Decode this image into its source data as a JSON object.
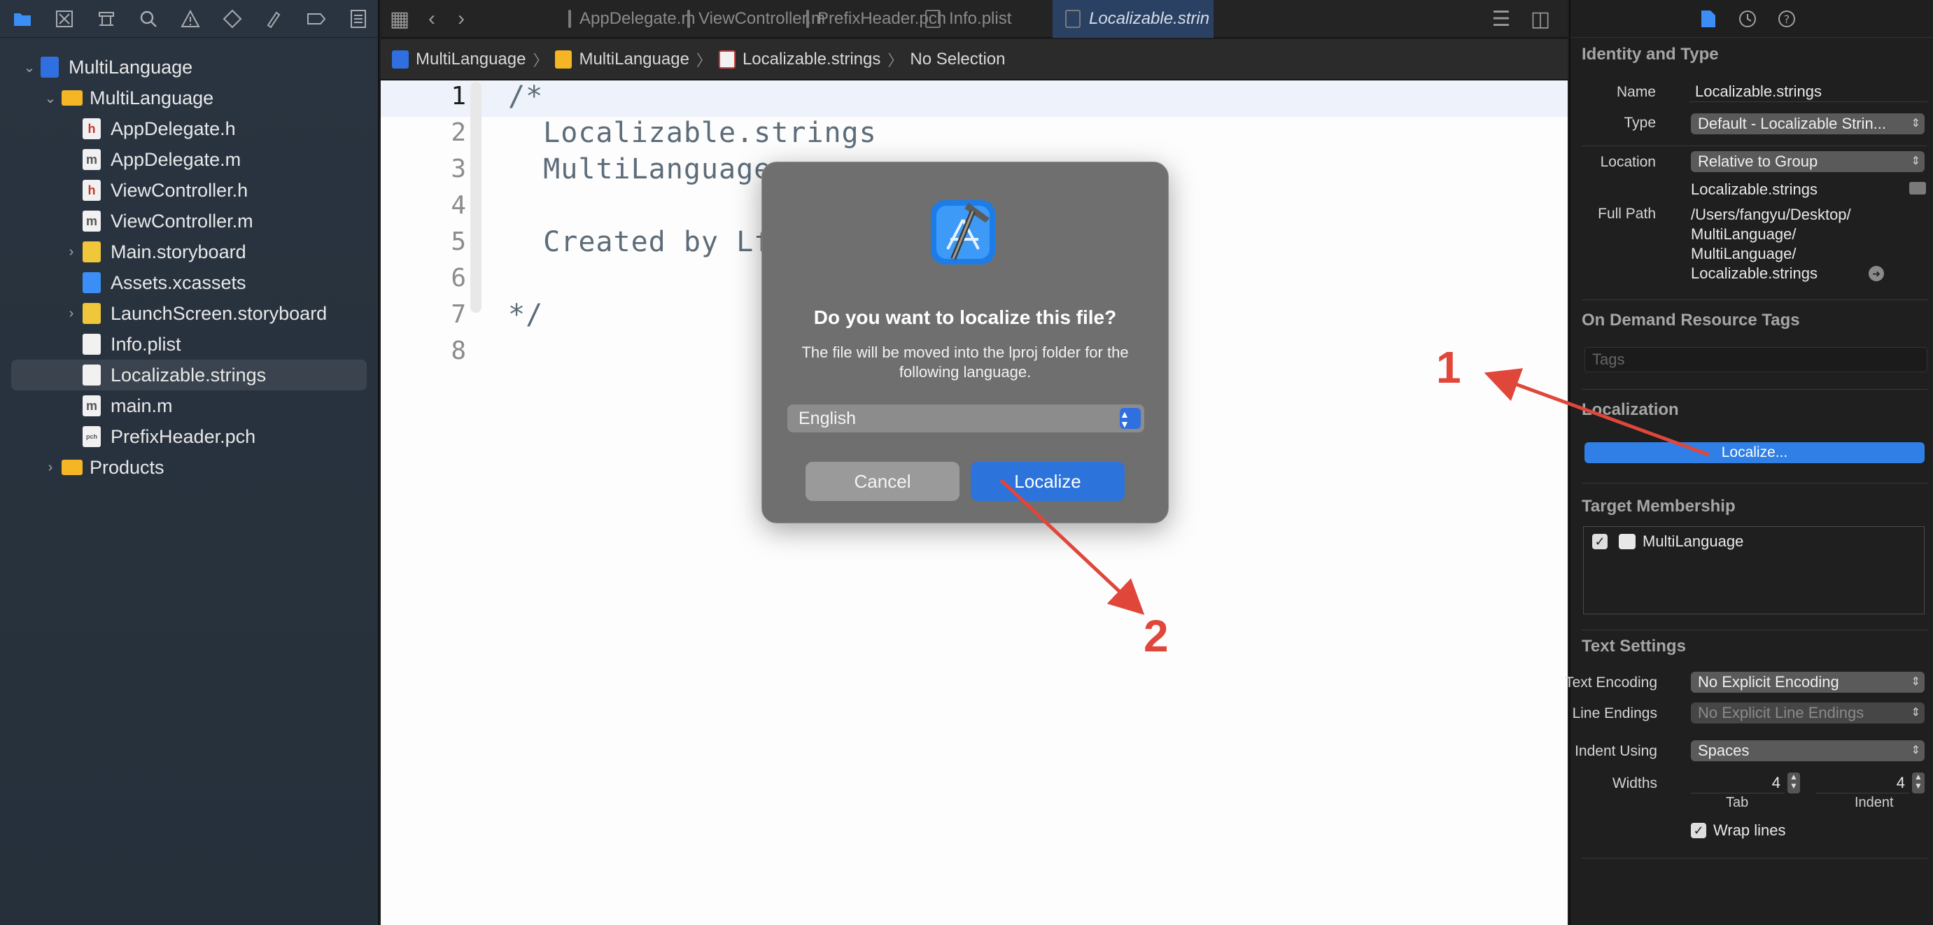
{
  "navigator": {
    "toolbar_icons": [
      "folder-icon",
      "source-control-icon",
      "symbol-icon",
      "find-icon",
      "issue-icon",
      "test-icon",
      "debug-icon",
      "breakpoint-icon",
      "report-icon"
    ],
    "tree": [
      {
        "label": "MultiLanguage",
        "kind": "project",
        "depth": 0,
        "expanded": true
      },
      {
        "label": "MultiLanguage",
        "kind": "folder",
        "depth": 1,
        "expanded": true
      },
      {
        "label": "AppDelegate.h",
        "kind": "h",
        "depth": 2
      },
      {
        "label": "AppDelegate.m",
        "kind": "m",
        "depth": 2
      },
      {
        "label": "ViewController.h",
        "kind": "h",
        "depth": 2
      },
      {
        "label": "ViewController.m",
        "kind": "m",
        "depth": 2
      },
      {
        "label": "Main.storyboard",
        "kind": "storyboard",
        "depth": 2,
        "expanded": false
      },
      {
        "label": "Assets.xcassets",
        "kind": "assets",
        "depth": 2
      },
      {
        "label": "LaunchScreen.storyboard",
        "kind": "storyboard",
        "depth": 2,
        "expanded": false
      },
      {
        "label": "Info.plist",
        "kind": "plist",
        "depth": 2
      },
      {
        "label": "Localizable.strings",
        "kind": "strings",
        "depth": 2,
        "selected": true
      },
      {
        "label": "main.m",
        "kind": "m",
        "depth": 2
      },
      {
        "label": "PrefixHeader.pch",
        "kind": "pch",
        "depth": 2
      },
      {
        "label": "Products",
        "kind": "folder",
        "depth": 1,
        "expanded": false
      }
    ]
  },
  "tabs": [
    {
      "label": "AppDelegate.m",
      "active": false
    },
    {
      "label": "ViewController.m",
      "active": false
    },
    {
      "label": "PrefixHeader.pch",
      "active": false
    },
    {
      "label": "Info.plist",
      "active": false
    },
    {
      "label": "Localizable.strin",
      "active": true
    }
  ],
  "jumpbar": {
    "project": "MultiLanguage",
    "group": "MultiLanguage",
    "file": "Localizable.strings",
    "selection": "No Selection"
  },
  "editor": {
    "current_line": 1,
    "lines": [
      "/*",
      "  Localizable.strings",
      "  MultiLanguage",
      "",
      "  Created by Lf",
      "",
      "*/",
      ""
    ]
  },
  "dialog": {
    "title": "Do you want to localize this file?",
    "message": "The file will be moved into the lproj folder for the following language.",
    "language": "English",
    "cancel": "Cancel",
    "confirm": "Localize"
  },
  "inspector": {
    "identity": {
      "section": "Identity and Type",
      "name_label": "Name",
      "name_value": "Localizable.strings",
      "type_label": "Type",
      "type_value": "Default - Localizable Strin...",
      "location_label": "Location",
      "location_value": "Relative to Group",
      "location_file": "Localizable.strings",
      "fullpath_label": "Full Path",
      "fullpath_lines": [
        "/Users/fangyu/Desktop/",
        "MultiLanguage/",
        "MultiLanguage/",
        "Localizable.strings"
      ]
    },
    "ondemand": {
      "section": "On Demand Resource Tags",
      "placeholder": "Tags"
    },
    "localization": {
      "section": "Localization",
      "button": "Localize..."
    },
    "membership": {
      "section": "Target Membership",
      "target": "MultiLanguage",
      "checked": true
    },
    "text_settings": {
      "section": "Text Settings",
      "encoding_label": "Text Encoding",
      "encoding_value": "No Explicit Encoding",
      "endings_label": "Line Endings",
      "endings_value": "No Explicit Line Endings",
      "indent_label": "Indent Using",
      "indent_value": "Spaces",
      "widths_label": "Widths",
      "tab_width": "4",
      "indent_width": "4",
      "tab_label": "Tab",
      "indent_sub_label": "Indent",
      "wrap_label": "Wrap lines",
      "wrap_checked": true
    }
  },
  "annotations": {
    "one": "1",
    "two": "2",
    "color": "#e0463a"
  },
  "colors": {
    "accent": "#2c73dc",
    "sidebar": "#2a3440",
    "editor_bg": "#fdfdfd"
  }
}
